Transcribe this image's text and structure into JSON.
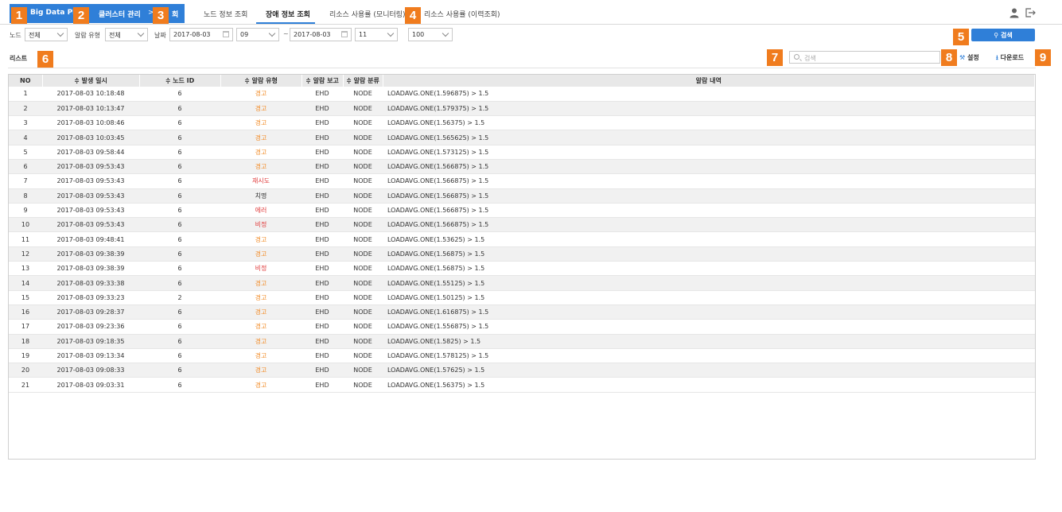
{
  "header": {
    "brand": "Big Data Pla",
    "crumb1": "클러스터 관리",
    "crumb_sep": ">",
    "crumb2": "회",
    "tabs": [
      {
        "label": "노드 정보 조회"
      },
      {
        "label": "장애 정보 조회"
      },
      {
        "label": "리소스 사용률 (모니터링)"
      },
      {
        "label": "리소스 사용률 (이력조회)"
      }
    ]
  },
  "filters": {
    "node_label": "노드",
    "node_value": "전체",
    "alarm_type_label": "알람 유형",
    "alarm_type_value": "전체",
    "date_label": "날짜",
    "start_date": "2017-08-03",
    "start_hour": "09",
    "tilde": "~",
    "end_date": "2017-08-03",
    "end_hour": "11",
    "page_size": "100",
    "search_button": "검색"
  },
  "list": {
    "title": "리스트",
    "search_placeholder": "검색",
    "settings": "설정",
    "download": "다운로드"
  },
  "table": {
    "columns": [
      "NO",
      "≑ 발생 일시",
      "≑ 노드 ID",
      "≑ 알람 유형",
      "≑ 알람 보고",
      "≑ 알람 분류",
      "알람 내역"
    ],
    "rows": [
      {
        "no": "1",
        "time": "2017-08-03 10:18:48",
        "node": "6",
        "type": "경고",
        "level": "warn",
        "report": "EHD",
        "cls": "NODE",
        "detail": "LOADAVG.ONE(1.596875) > 1.5"
      },
      {
        "no": "2",
        "time": "2017-08-03 10:13:47",
        "node": "6",
        "type": "경고",
        "level": "warn",
        "report": "EHD",
        "cls": "NODE",
        "detail": "LOADAVG.ONE(1.579375) > 1.5"
      },
      {
        "no": "3",
        "time": "2017-08-03 10:08:46",
        "node": "6",
        "type": "경고",
        "level": "warn",
        "report": "EHD",
        "cls": "NODE",
        "detail": "LOADAVG.ONE(1.56375) > 1.5"
      },
      {
        "no": "4",
        "time": "2017-08-03 10:03:45",
        "node": "6",
        "type": "경고",
        "level": "warn",
        "report": "EHD",
        "cls": "NODE",
        "detail": "LOADAVG.ONE(1.565625) > 1.5"
      },
      {
        "no": "5",
        "time": "2017-08-03 09:58:44",
        "node": "6",
        "type": "경고",
        "level": "warn",
        "report": "EHD",
        "cls": "NODE",
        "detail": "LOADAVG.ONE(1.573125) > 1.5"
      },
      {
        "no": "6",
        "time": "2017-08-03 09:53:43",
        "node": "6",
        "type": "경고",
        "level": "warn",
        "report": "EHD",
        "cls": "NODE",
        "detail": "LOADAVG.ONE(1.566875) > 1.5"
      },
      {
        "no": "7",
        "time": "2017-08-03 09:53:43",
        "node": "6",
        "type": "재시도",
        "level": "err",
        "report": "EHD",
        "cls": "NODE",
        "detail": "LOADAVG.ONE(1.566875) > 1.5"
      },
      {
        "no": "8",
        "time": "2017-08-03 09:53:43",
        "node": "6",
        "type": "치명",
        "level": "crit",
        "report": "EHD",
        "cls": "NODE",
        "detail": "LOADAVG.ONE(1.566875) > 1.5"
      },
      {
        "no": "9",
        "time": "2017-08-03 09:53:43",
        "node": "6",
        "type": "에러",
        "level": "err",
        "report": "EHD",
        "cls": "NODE",
        "detail": "LOADAVG.ONE(1.566875) > 1.5"
      },
      {
        "no": "10",
        "time": "2017-08-03 09:53:43",
        "node": "6",
        "type": "비정",
        "level": "err",
        "report": "EHD",
        "cls": "NODE",
        "detail": "LOADAVG.ONE(1.566875) > 1.5"
      },
      {
        "no": "11",
        "time": "2017-08-03 09:48:41",
        "node": "6",
        "type": "경고",
        "level": "warn",
        "report": "EHD",
        "cls": "NODE",
        "detail": "LOADAVG.ONE(1.53625) > 1.5"
      },
      {
        "no": "12",
        "time": "2017-08-03 09:38:39",
        "node": "6",
        "type": "경고",
        "level": "warn",
        "report": "EHD",
        "cls": "NODE",
        "detail": "LOADAVG.ONE(1.56875) > 1.5"
      },
      {
        "no": "13",
        "time": "2017-08-03 09:38:39",
        "node": "6",
        "type": "비정",
        "level": "err",
        "report": "EHD",
        "cls": "NODE",
        "detail": "LOADAVG.ONE(1.56875) > 1.5"
      },
      {
        "no": "14",
        "time": "2017-08-03 09:33:38",
        "node": "6",
        "type": "경고",
        "level": "warn",
        "report": "EHD",
        "cls": "NODE",
        "detail": "LOADAVG.ONE(1.55125) > 1.5"
      },
      {
        "no": "15",
        "time": "2017-08-03 09:33:23",
        "node": "2",
        "type": "경고",
        "level": "warn",
        "report": "EHD",
        "cls": "NODE",
        "detail": "LOADAVG.ONE(1.50125) > 1.5"
      },
      {
        "no": "16",
        "time": "2017-08-03 09:28:37",
        "node": "6",
        "type": "경고",
        "level": "warn",
        "report": "EHD",
        "cls": "NODE",
        "detail": "LOADAVG.ONE(1.616875) > 1.5"
      },
      {
        "no": "17",
        "time": "2017-08-03 09:23:36",
        "node": "6",
        "type": "경고",
        "level": "warn",
        "report": "EHD",
        "cls": "NODE",
        "detail": "LOADAVG.ONE(1.556875) > 1.5"
      },
      {
        "no": "18",
        "time": "2017-08-03 09:18:35",
        "node": "6",
        "type": "경고",
        "level": "warn",
        "report": "EHD",
        "cls": "NODE",
        "detail": "LOADAVG.ONE(1.5825) > 1.5"
      },
      {
        "no": "19",
        "time": "2017-08-03 09:13:34",
        "node": "6",
        "type": "경고",
        "level": "warn",
        "report": "EHD",
        "cls": "NODE",
        "detail": "LOADAVG.ONE(1.578125) > 1.5"
      },
      {
        "no": "20",
        "time": "2017-08-03 09:08:33",
        "node": "6",
        "type": "경고",
        "level": "warn",
        "report": "EHD",
        "cls": "NODE",
        "detail": "LOADAVG.ONE(1.57625) > 1.5"
      },
      {
        "no": "21",
        "time": "2017-08-03 09:03:31",
        "node": "6",
        "type": "경고",
        "level": "warn",
        "report": "EHD",
        "cls": "NODE",
        "detail": "LOADAVG.ONE(1.56375) > 1.5"
      }
    ]
  },
  "badges": [
    "1",
    "2",
    "3",
    "4",
    "5",
    "6",
    "7",
    "8",
    "9"
  ],
  "colors": {
    "accent": "#2f7fd8",
    "badge": "#f07c1e",
    "warn": "#f28c28",
    "error": "#e03b3b"
  }
}
